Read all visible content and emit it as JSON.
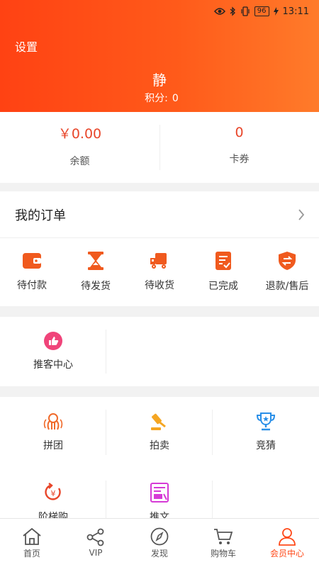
{
  "status_bar": {
    "battery": "96",
    "time": "13:11"
  },
  "header": {
    "settings_label": "设置",
    "username": "静",
    "points_label": "积分:",
    "points_value": "0"
  },
  "wallet": [
    {
      "value": "￥0.00",
      "label": "余额"
    },
    {
      "value": "0",
      "label": "卡券"
    }
  ],
  "orders": {
    "title": "我的订单",
    "items": [
      {
        "label": "待付款",
        "icon": "wallet-icon"
      },
      {
        "label": "待发货",
        "icon": "hourglass-icon"
      },
      {
        "label": "待收货",
        "icon": "truck-icon"
      },
      {
        "label": "已完成",
        "icon": "checklist-icon"
      },
      {
        "label": "退款/售后",
        "icon": "refund-shield-icon"
      }
    ]
  },
  "promo": {
    "label": "推客中心",
    "icon": "thumbs-up-icon"
  },
  "tools": [
    {
      "label": "拼团",
      "icon": "group-icon"
    },
    {
      "label": "拍卖",
      "icon": "gavel-icon"
    },
    {
      "label": "竞猜",
      "icon": "trophy-icon"
    },
    {
      "label": "阶梯购",
      "icon": "ladder-buy-icon"
    },
    {
      "label": "推文",
      "icon": "article-icon"
    }
  ],
  "tabbar": [
    {
      "label": "首页",
      "icon": "home-icon"
    },
    {
      "label": "VIP",
      "icon": "share-icon"
    },
    {
      "label": "发现",
      "icon": "compass-icon"
    },
    {
      "label": "购物车",
      "icon": "cart-icon"
    },
    {
      "label": "会员中心",
      "icon": "user-icon",
      "active": true
    }
  ],
  "colors": {
    "header_start": "#ff4213",
    "header_end": "#ff7b2a",
    "accent": "#e8462a",
    "active_tab": "#ff4a1a"
  }
}
